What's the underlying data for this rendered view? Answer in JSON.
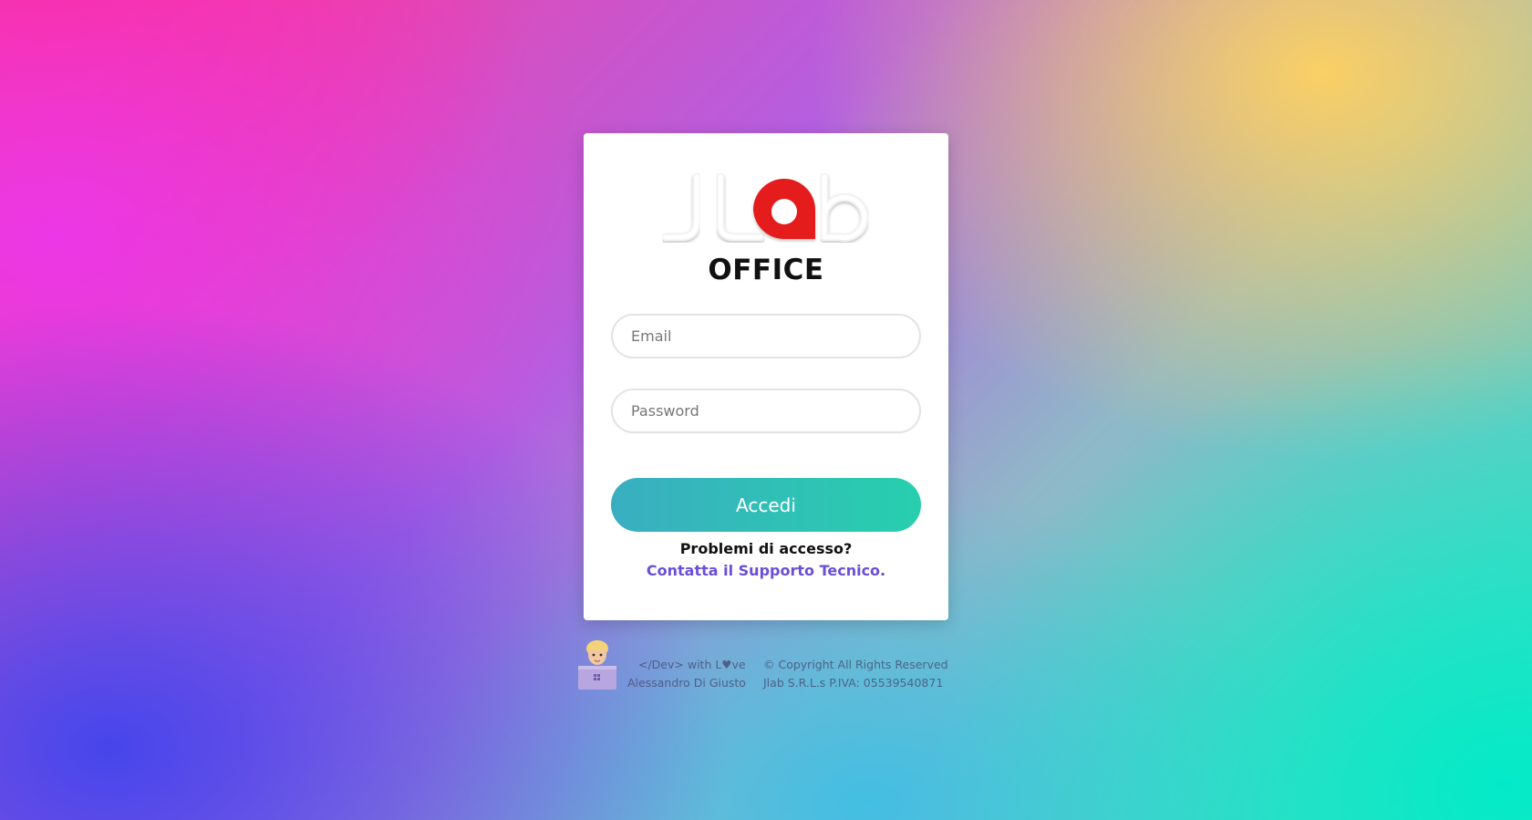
{
  "brand": {
    "logo_text": "JLab",
    "app_title": "OFFICE",
    "logo_accent_color": "#e41e1e"
  },
  "login_form": {
    "email_placeholder": "Email",
    "password_placeholder": "Password",
    "submit_label": "Accedi",
    "submit_gradient": [
      "#3aaec0",
      "#27cfae"
    ],
    "help_question": "Problemi di accesso?",
    "support_link_label": "Contatta il Supporto Tecnico.",
    "support_link_color": "#6a4fd8"
  },
  "footer": {
    "dev_line": "</Dev> with L♥ve",
    "dev_name": "Alessandro Di Giusto",
    "copyright": "© Copyright All Rights Reserved",
    "company": "Jlab S.R.L.s  P.IVA: 05539540871",
    "avatar_icon": "developer-with-laptop-icon"
  }
}
